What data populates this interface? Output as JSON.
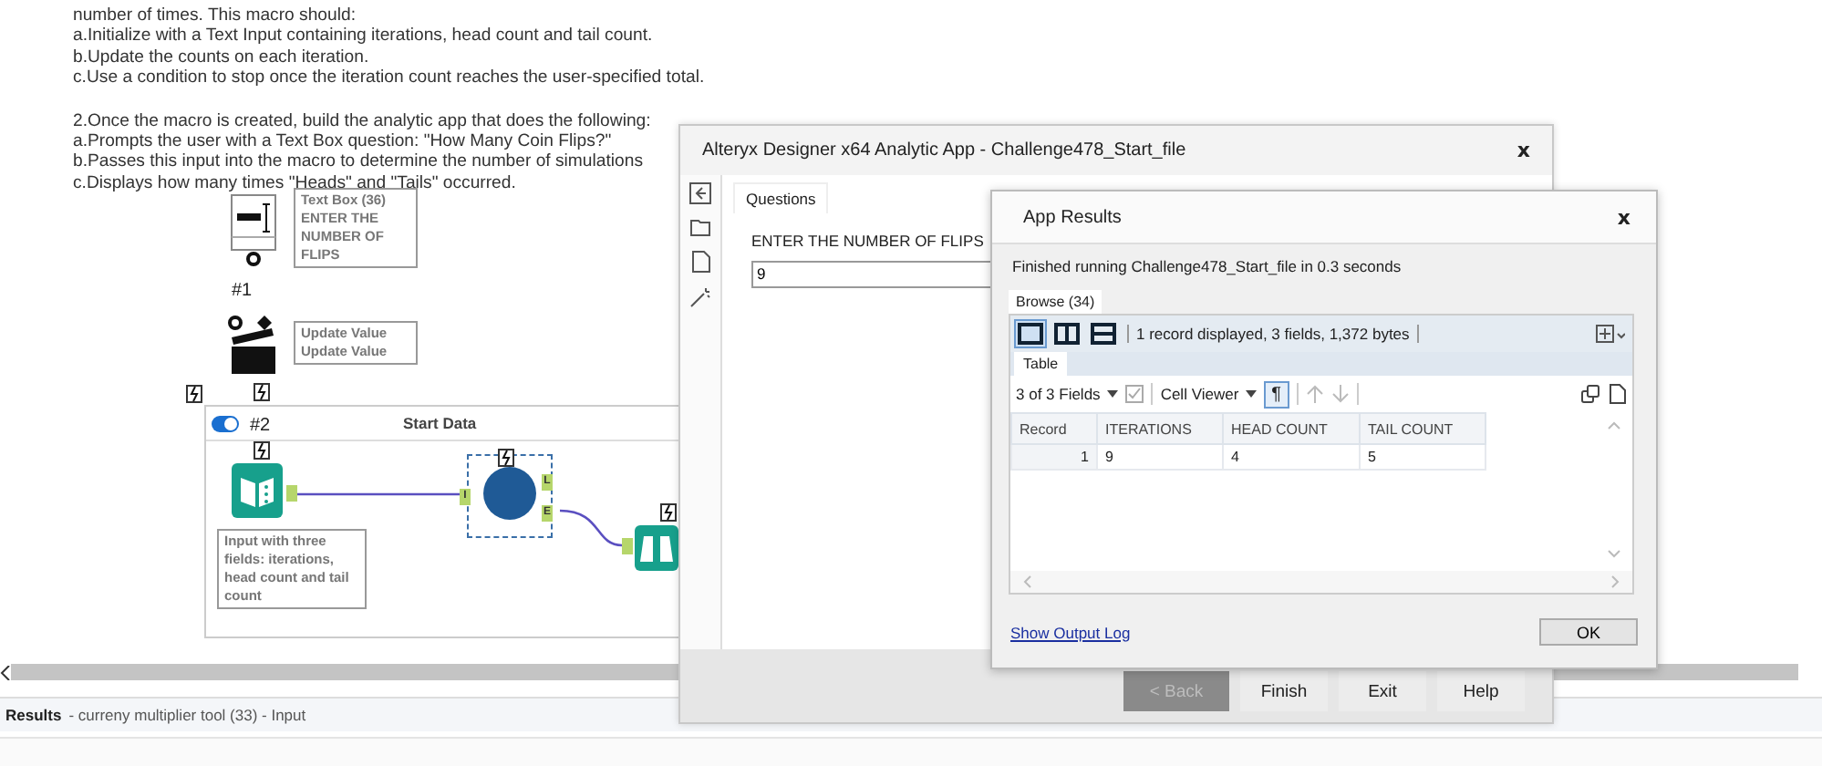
{
  "instructions": [
    {
      "lines": [
        "number of times. This macro should:",
        "a.Initialize with a Text Input containing iterations, head count and tail count.",
        "b.Update the counts on each iteration.",
        "c.Use a condition to stop once the iteration count reaches the user-specified total."
      ]
    },
    {
      "lines": [
        "2.Once the macro is created, build the analytic app that does the following:",
        "a.Prompts the user with a Text Box question: \"How Many Coin Flips?\"",
        "b.Passes this input into the macro to determine the number of simulations",
        "c.Displays how many times \"Heads\" and \"Tails\" occurred."
      ]
    }
  ],
  "workflow": {
    "textbox_note": {
      "title": "Text Box (36)",
      "text": "ENTER THE NUMBER OF FLIPS"
    },
    "tool_number_1": "#1",
    "update_note": [
      "Update Value",
      "Update Value"
    ],
    "container": {
      "title": "Start Data",
      "enabled": true,
      "tool_number": "#2"
    },
    "input_note": "Input with three fields: iterations, head count and tail count",
    "macro_anchors": [
      "L",
      "E"
    ],
    "input_anchor": "I"
  },
  "results_bar": {
    "title": "Results",
    "subtitle": "- curreny multiplier tool (33) - Input"
  },
  "app_window": {
    "title": "Alteryx Designer x64 Analytic App - Challenge478_Start_file",
    "close": "x",
    "tabs": [
      {
        "label": "Questions",
        "selected": true
      }
    ],
    "question": {
      "label": "ENTER THE NUMBER OF FLIPS",
      "value": "9"
    },
    "buttons": [
      {
        "label": "< Back",
        "disabled": true
      },
      {
        "label": "Finish",
        "disabled": false
      },
      {
        "label": "Exit",
        "disabled": false
      },
      {
        "label": "Help",
        "disabled": false
      }
    ]
  },
  "results_dialog": {
    "title": "App Results",
    "close": "x",
    "message": "Finished running Challenge478_Start_file in 0.3 seconds",
    "tabs": [
      {
        "label": "Browse (34)",
        "selected": true
      }
    ],
    "layouts": [
      {
        "selected": true
      },
      {
        "selected": false
      },
      {
        "selected": false
      }
    ],
    "summary": "1 record displayed, 3 fields, 1,372 bytes",
    "view_tabs": [
      {
        "label": "Table",
        "selected": true
      }
    ],
    "fields_dropdown": "3 of 3 Fields",
    "cell_viewer": "Cell Viewer",
    "pilcrow": {
      "label": "¶",
      "selected": true
    },
    "columns": [
      "Record",
      "ITERATIONS",
      "HEAD COUNT",
      "TAIL COUNT"
    ],
    "rows": [
      [
        "1",
        "9",
        "4",
        "5"
      ]
    ],
    "link": "Show Output Log",
    "ok": "OK"
  }
}
